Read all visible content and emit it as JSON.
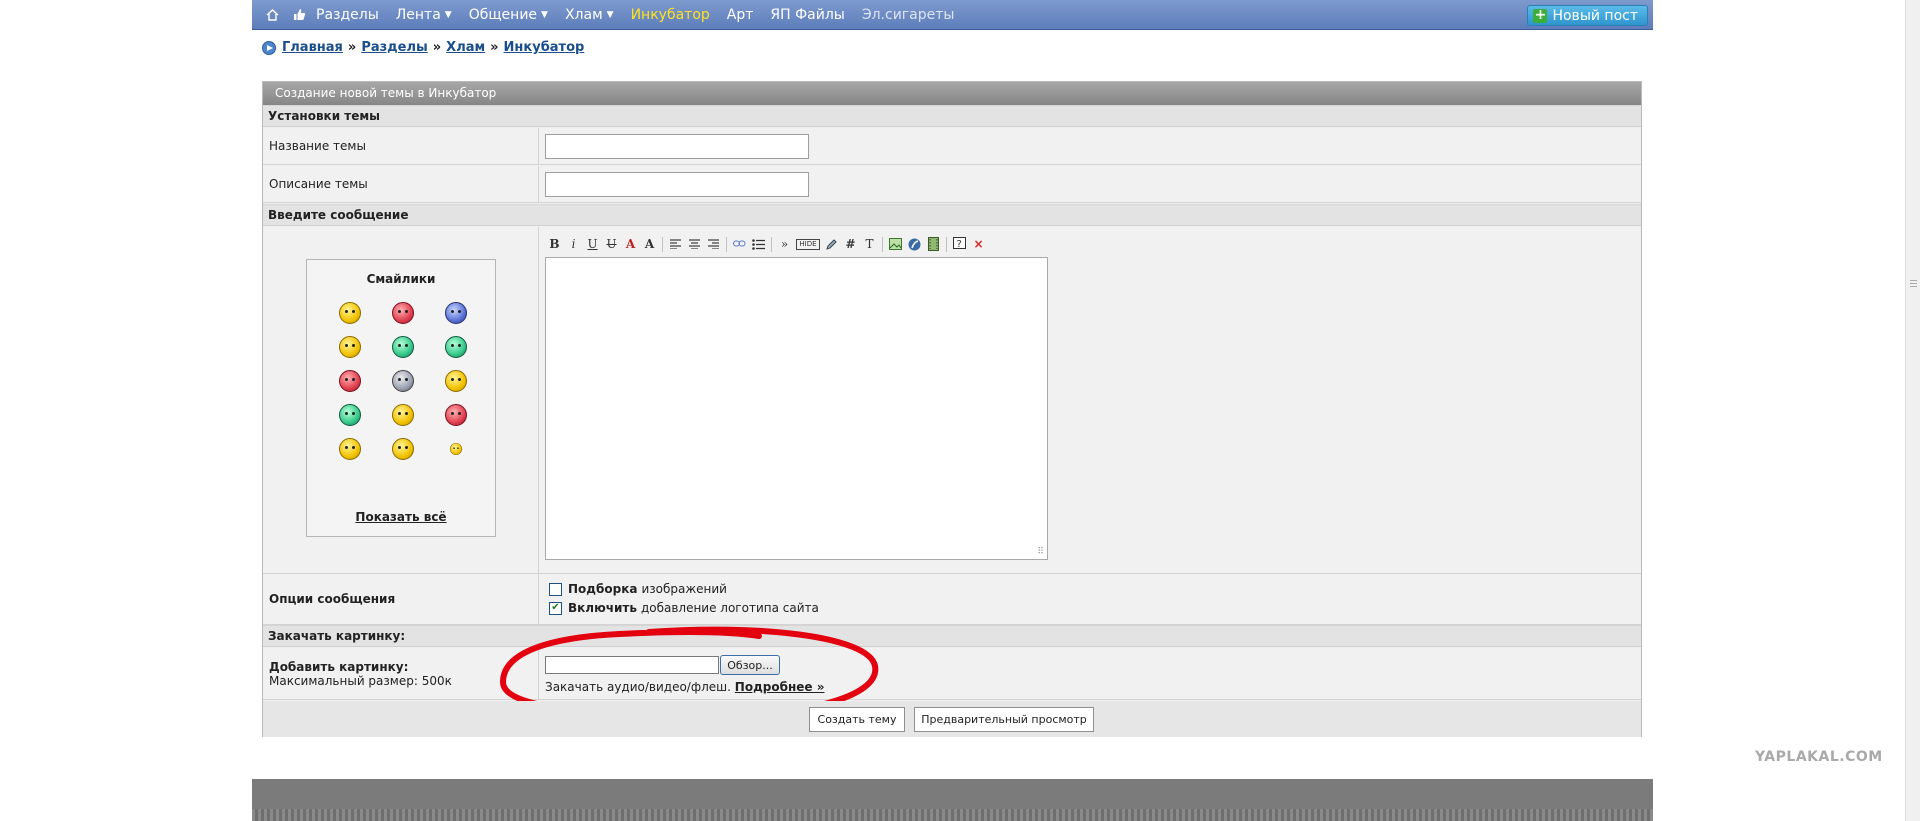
{
  "nav": {
    "home_icon": "home-icon",
    "like_icon": "thumbs-up-icon",
    "items": [
      {
        "label": "Разделы",
        "dropdown": false,
        "style": "normal"
      },
      {
        "label": "Лента",
        "dropdown": true,
        "style": "normal"
      },
      {
        "label": "Общение",
        "dropdown": true,
        "style": "normal"
      },
      {
        "label": "Хлам",
        "dropdown": true,
        "style": "normal"
      },
      {
        "label": "Инкубатор",
        "dropdown": false,
        "style": "accent"
      },
      {
        "label": "Арт",
        "dropdown": false,
        "style": "normal"
      },
      {
        "label": "ЯП Файлы",
        "dropdown": false,
        "style": "normal"
      },
      {
        "label": "Эл.сигареты",
        "dropdown": false,
        "style": "dim"
      }
    ],
    "new_post": "Новый пост",
    "accent_color": "#ffe21f",
    "bar_color": "#6b89c4"
  },
  "breadcrumb": {
    "items": [
      "Главная",
      "Разделы",
      "Хлам",
      "Инкубатор"
    ],
    "separator": "»"
  },
  "form": {
    "title": "Создание новой темы в Инкубатор",
    "settings_header": "Установки темы",
    "topic_name_label": "Название темы",
    "topic_name_value": "",
    "topic_desc_label": "Описание темы",
    "topic_desc_value": "",
    "message_header": "Введите сообщение",
    "smileys": {
      "title": "Смайлики",
      "show_all": "Показать всё"
    },
    "toolbar_icons": [
      "bold-icon",
      "italic-icon",
      "underline-icon",
      "strikethrough-icon",
      "font-color-icon",
      "font-size-icon",
      "align-left-icon",
      "align-center-icon",
      "align-right-icon",
      "link-icon",
      "list-icon",
      "quote-icon",
      "hide-icon",
      "edit-icon",
      "hash-icon",
      "text-icon",
      "image-icon",
      "flash-icon",
      "video-icon",
      "help-icon",
      "close-icon"
    ],
    "toolbar_glyphs": {
      "bold": "B",
      "italic": "i",
      "underline": "U",
      "strike": "U",
      "color": "A",
      "size": "A",
      "quote": "»",
      "hide": "HIDE",
      "hash": "#",
      "text": "T",
      "close": "×"
    },
    "message_value": "",
    "options_label": "Опции сообщения",
    "option_gallery_bold": "Подборка",
    "option_gallery_rest": "изображений",
    "option_gallery_checked": false,
    "option_logo_bold": "Включить",
    "option_logo_rest": "добавление логотипа сайта",
    "option_logo_checked": true,
    "upload_header": "Закачать картинку:",
    "upload_label": "Добавить картинку:",
    "upload_limit": "Максимальный размер: 500к",
    "browse_button": "Обзор...",
    "upload_hint": "Закачать аудио/видео/флеш.",
    "upload_more": "Подробнее »",
    "submit_button": "Создать тему",
    "preview_button": "Предварительный просмотр"
  },
  "watermark": "YAPLAKAL.COM"
}
